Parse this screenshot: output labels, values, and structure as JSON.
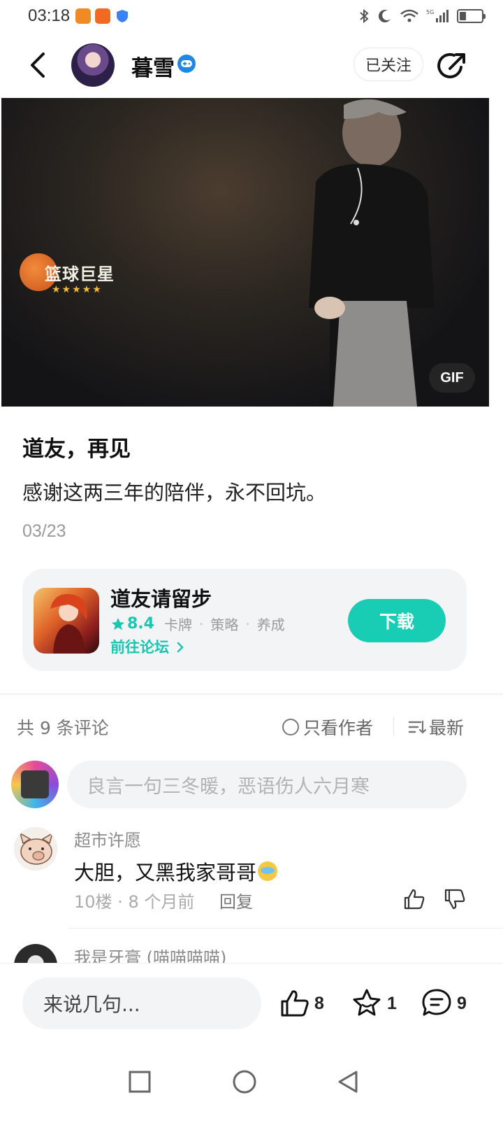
{
  "status_bar": {
    "time": "03:18",
    "app_icons": [
      "orange-app-icon",
      "orange-app-icon-2",
      "shield-icon"
    ],
    "network": "5G",
    "colors": {
      "app_icon_1": "#f08a24",
      "app_icon_2": "#f06a24",
      "shield": "#3b82f6"
    }
  },
  "header": {
    "author_name": "暮雪",
    "follow_label": "已关注"
  },
  "media": {
    "logo_text": "篮球巨星",
    "logo_stars": "★★★★★",
    "badge": "GIF"
  },
  "post": {
    "title": "道友，再见",
    "body": "感谢这两三年的陪伴，永不回坑。",
    "date": "03/23"
  },
  "game_card": {
    "name": "道友请留步",
    "score": "8.4",
    "tags": [
      "卡牌",
      "策略",
      "养成"
    ],
    "tag_separator": "·",
    "forum_link": "前往论坛",
    "download_label": "下载",
    "accent_color": "#19cdb5"
  },
  "comments": {
    "count_label": "共 9 条评论",
    "filter_author_only": "只看作者",
    "sort_label": "最新",
    "input_placeholder": "良言一句三冬暖，恶语伤人六月寒",
    "items": [
      {
        "name": "超市许愿",
        "text": "大胆，又黑我家哥哥",
        "floor": "10楼",
        "time": "8 个月前",
        "reply_label": "回复"
      },
      {
        "name": "我是牙膏 (喵喵喵喵)"
      }
    ]
  },
  "bottom_bar": {
    "input_placeholder": "来说几句...",
    "like_count": "8",
    "favorite_count": "1",
    "comment_count": "9"
  }
}
